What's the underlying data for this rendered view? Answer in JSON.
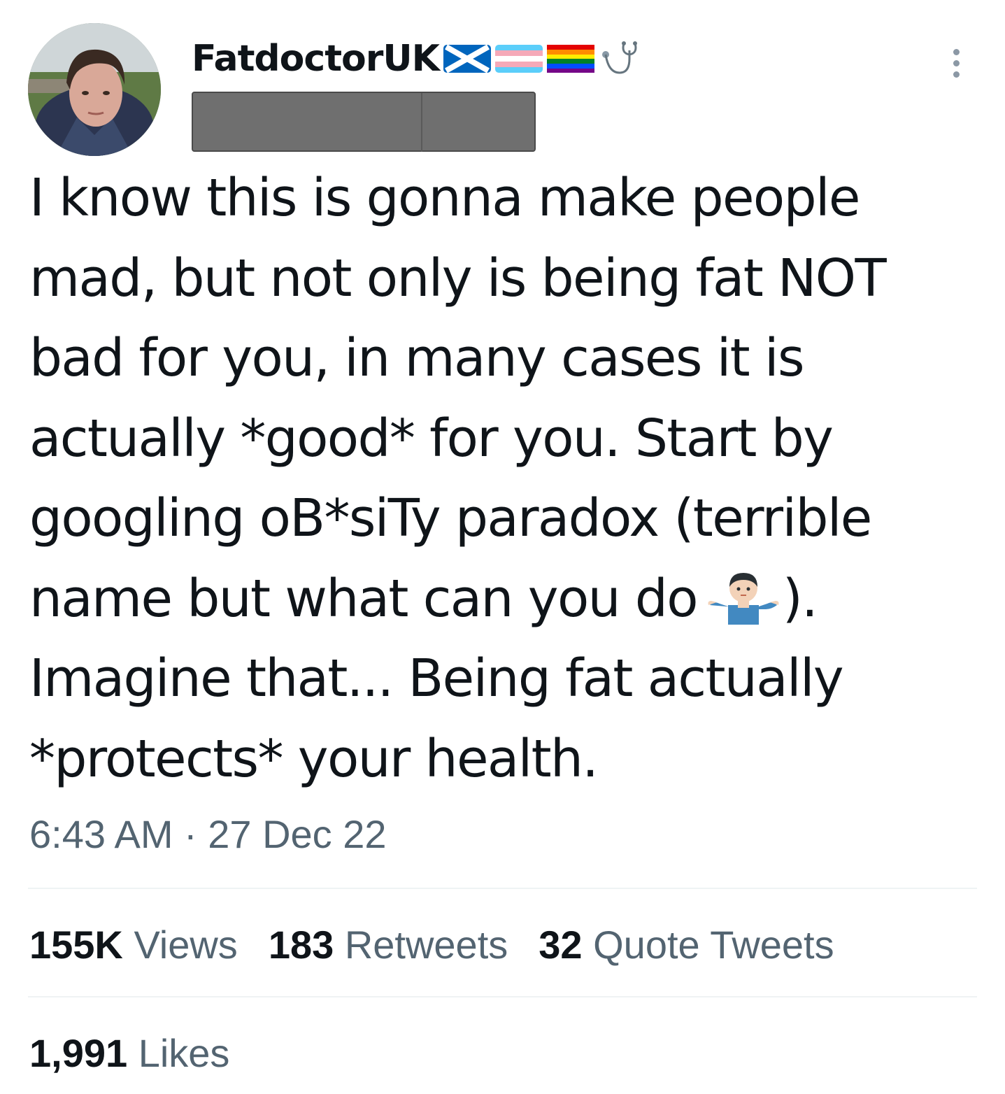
{
  "author": {
    "display_name": "FatdoctorUK",
    "flags": [
      "scotland-flag-icon",
      "trans-flag-icon",
      "rainbow-flag-icon",
      "stethoscope-icon"
    ]
  },
  "tweet": {
    "lines": [
      "I know this is gonna make people",
      "mad, but not only is being fat NOT",
      "bad for you, in many cases it is",
      "actually *good* for you. Start by",
      "googling oB*siTy paradox (terrible",
      "name but what can you do",
      "Imagine that... Being fat actually",
      "*protects* your health."
    ],
    "line6_after_emoji": ").",
    "timestamp": "6:43 AM · 27 Dec 22"
  },
  "stats": {
    "views_num": "155K",
    "views_label": "Views",
    "retweets_num": "183",
    "retweets_label": "Retweets",
    "quotes_num": "32",
    "quotes_label": "Quote Tweets",
    "likes_num": "1,991",
    "likes_label": "Likes"
  },
  "colors": {
    "text": "#0f1419",
    "secondary": "#536471",
    "divider": "#eff3f4",
    "redaction": "#6f6f6f"
  }
}
